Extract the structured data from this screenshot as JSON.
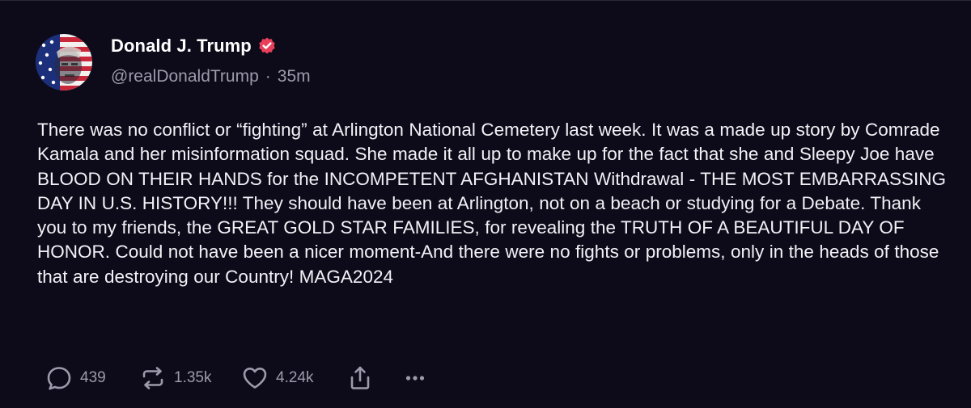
{
  "post": {
    "author": {
      "display_name": "Donald J. Trump",
      "handle": "@realDonaldTrump",
      "separator": "·",
      "time_ago": "35m",
      "verified": true
    },
    "text": "There was no conflict or “fighting” at Arlington National Cemetery last week. It was a made up story by Comrade Kamala and her misinformation squad. She made it all up to make up for the fact that she and Sleepy Joe have BLOOD ON THEIR HANDS for the INCOMPETENT AFGHANISTAN Withdrawal - THE MOST EMBARRASSING DAY IN U.S. HISTORY!!! They should have been at Arlington, not on a beach or studying for a Debate. Thank you to my friends, the GREAT GOLD STAR FAMILIES, for revealing the TRUTH OF A BEAUTIFUL DAY OF HONOR. Could not have been a nicer moment-And there were no fights or problems, only in the heads of those that are destroying our Country! MAGA2024",
    "actions": {
      "reply": {
        "icon": "reply-icon",
        "count": "439"
      },
      "repost": {
        "icon": "repost-icon",
        "count": "1.35k"
      },
      "like": {
        "icon": "heart-icon",
        "count": "4.24k"
      },
      "share": {
        "icon": "share-icon"
      },
      "more": {
        "icon": "more-icon"
      }
    }
  },
  "colors": {
    "background": "#0d0b19",
    "text_primary": "#f2f1f6",
    "text_secondary": "#9d9aab",
    "verified_badge": "#e8405a"
  }
}
